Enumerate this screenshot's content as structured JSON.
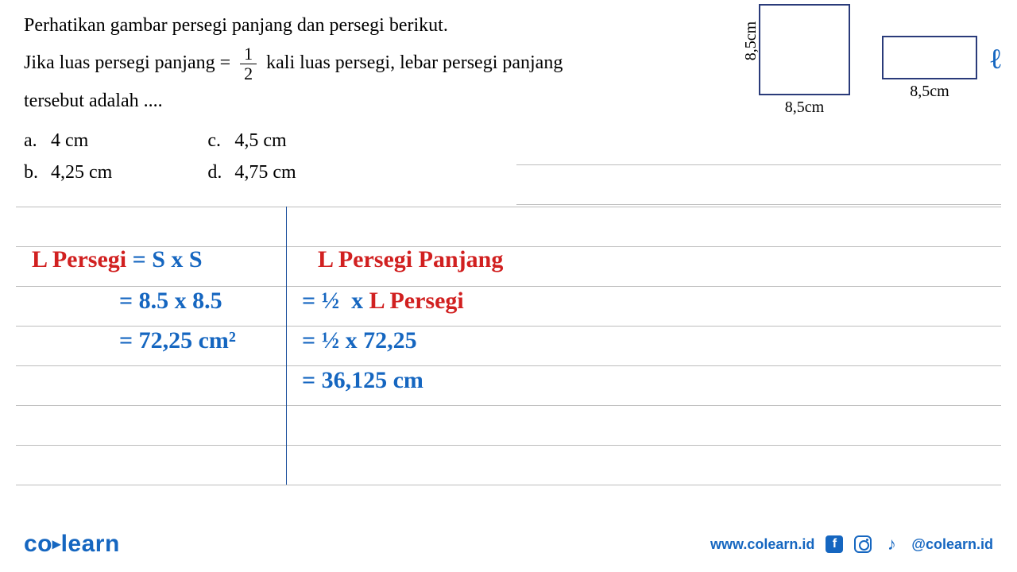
{
  "question": {
    "line1": "Perhatikan gambar persegi panjang dan persegi berikut.",
    "line2_pre": "Jika luas persegi panjang =",
    "frac_num": "1",
    "frac_den": "2",
    "line2_post": "kali luas persegi, lebar persegi panjang",
    "line3": "tersebut adalah ...."
  },
  "options": {
    "a": {
      "label": "a.",
      "text": "4 cm"
    },
    "b": {
      "label": "b.",
      "text": "4,25 cm"
    },
    "c": {
      "label": "c.",
      "text": "4,5 cm"
    },
    "d": {
      "label": "d.",
      "text": "4,75 cm"
    }
  },
  "figures": {
    "square_side": "8,5cm",
    "square_bottom": "8,5cm",
    "rect_right": "ℓ",
    "rect_bottom": "8,5cm"
  },
  "work": {
    "left": {
      "l1_red": "L Persegi",
      "l1_blue": "= S x S",
      "l2": "= 8.5 x 8.5",
      "l3": "= 72,25 cm²"
    },
    "right": {
      "l1": "L Persegi Panjang",
      "l2": "= ½  x L Persegi",
      "l3": "= ½  x 72,25",
      "l4": "= 36,125 cm"
    }
  },
  "footer": {
    "brand_co": "co",
    "brand_learn": "learn",
    "url": "www.colearn.id",
    "handle": "@colearn.id"
  },
  "chart_data": {
    "type": "table",
    "shapes": [
      {
        "name": "persegi",
        "width_cm": 8.5,
        "height_cm": 8.5
      },
      {
        "name": "persegi_panjang",
        "width_cm": 8.5,
        "height_label": "ℓ"
      }
    ],
    "computed": {
      "luas_persegi_cm2": 72.25,
      "luas_persegi_panjang_cm2": 36.125
    },
    "answer_choices": [
      {
        "key": "a",
        "value_cm": 4
      },
      {
        "key": "b",
        "value_cm": 4.25
      },
      {
        "key": "c",
        "value_cm": 4.5
      },
      {
        "key": "d",
        "value_cm": 4.75
      }
    ]
  }
}
